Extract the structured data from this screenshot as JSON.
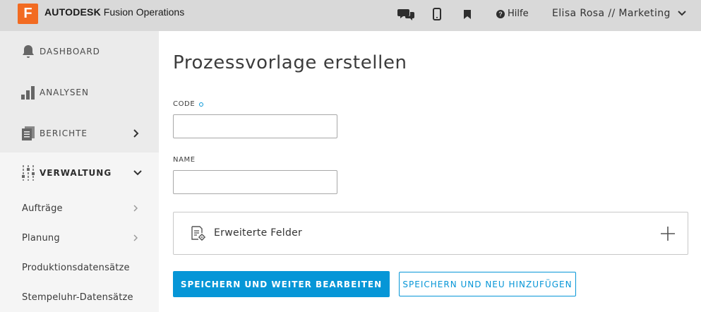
{
  "header": {
    "logo_letter": "F",
    "brand_bold": "AUTODESK",
    "brand_rest": " Fusion Operations",
    "help_label": "Hilfe",
    "user_label": "Elisa Rosa // Marketing",
    "icons": [
      "chat-icon",
      "mobile-icon",
      "bookmark-icon",
      "help-icon",
      "chevron-down-icon"
    ]
  },
  "sidebar": {
    "main_items": [
      {
        "label": "DASHBOARD",
        "icon": "bell-icon"
      },
      {
        "label": "ANALYSEN",
        "icon": "bar-chart-icon"
      },
      {
        "label": "BERICHTE",
        "icon": "reports-icon"
      },
      {
        "label": "VERWALTUNG",
        "icon": "sliders-icon"
      }
    ],
    "sub_items": [
      {
        "label": "Aufträge"
      },
      {
        "label": "Planung"
      },
      {
        "label": "Produktionsdatensätze"
      },
      {
        "label": "Stempeluhr-Datensätze"
      }
    ]
  },
  "main": {
    "title": "Prozessvorlage erstellen",
    "code_label": "CODE",
    "code_value": "",
    "name_label": "NAME",
    "name_value": "",
    "extended_fields_label": "Erweiterte Felder",
    "save_continue_label": "SPEICHERN UND WEITER BEARBEITEN",
    "save_new_label": "SPEICHERN UND NEU HINZUFÜGEN"
  },
  "colors": {
    "accent": "#0696d7",
    "logo": "#f26b21",
    "topbar": "#d9d9d9",
    "sidebar": "#ebebeb"
  }
}
